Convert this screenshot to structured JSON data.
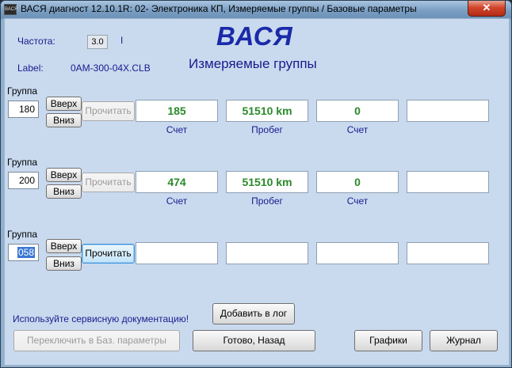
{
  "window": {
    "title": "ВАСЯ диагност 12.10.1R: 02- Электроника КП,  Измеряемые группы / Базовые параметры",
    "icon_label": "ВАСЯ",
    "close_glyph": "✕"
  },
  "header": {
    "freq_label": "Частота:",
    "freq_value": "3.0",
    "freq_tick": "I",
    "label_label": "Label:",
    "label_value": "0AM-300-04X.CLB",
    "brand": "ВАСЯ",
    "subtitle": "Измеряемые группы"
  },
  "groups": [
    {
      "caption": "Группа",
      "number": "180",
      "up_label": "Вверх",
      "down_label": "Вниз",
      "read_label": "Прочитать",
      "read_enabled": false,
      "fields": [
        {
          "value": "185",
          "unit": "Счет"
        },
        {
          "value": "51510 km",
          "unit": "Пробег"
        },
        {
          "value": "0",
          "unit": "Счет"
        },
        {
          "value": "",
          "unit": ""
        }
      ]
    },
    {
      "caption": "Группа",
      "number": "200",
      "up_label": "Вверх",
      "down_label": "Вниз",
      "read_label": "Прочитать",
      "read_enabled": false,
      "fields": [
        {
          "value": "474",
          "unit": "Счет"
        },
        {
          "value": "51510 km",
          "unit": "Пробег"
        },
        {
          "value": "0",
          "unit": "Счет"
        },
        {
          "value": "",
          "unit": ""
        }
      ]
    },
    {
      "caption": "Группа",
      "number": "058",
      "up_label": "Вверх",
      "down_label": "Вниз",
      "read_label": "Прочитать",
      "read_enabled": true,
      "fields": [
        {
          "value": "",
          "unit": ""
        },
        {
          "value": "",
          "unit": ""
        },
        {
          "value": "",
          "unit": ""
        },
        {
          "value": "",
          "unit": ""
        }
      ]
    }
  ],
  "footer": {
    "hint": "Используйте сервисную документацию!",
    "add_log_label": "Добавить в лог",
    "switch_basic_label": "Переключить в Баз. параметры",
    "done_back_label": "Готово, Назад",
    "graphs_label": "Графики",
    "journal_label": "Журнал"
  },
  "colors": {
    "value_text": "#2a8a2a",
    "label_text": "#1a1a8c",
    "brand_text": "#1a2aa8",
    "client_bg": "#c9daef"
  }
}
